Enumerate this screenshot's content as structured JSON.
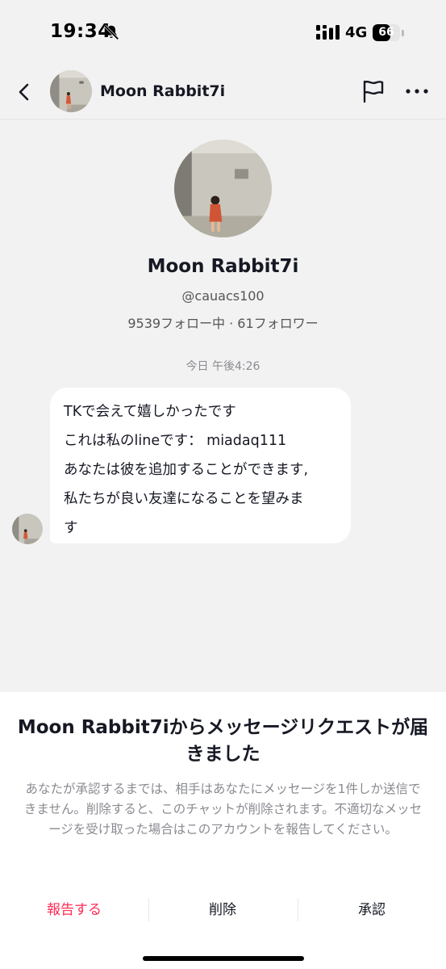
{
  "status_bar": {
    "time": "19:34",
    "network": "4G",
    "battery_level": "66",
    "battery_fraction": 0.66,
    "icons": [
      "bell-off-icon",
      "signal-icon"
    ]
  },
  "header": {
    "name": "Moon Rabbit7i",
    "icons": [
      "back-icon",
      "flag-icon",
      "more-icon"
    ]
  },
  "profile": {
    "name": "Moon Rabbit7i",
    "handle": "@cauacs100",
    "stats": "9539フォロー中 · 61フォロワー"
  },
  "chat": {
    "timestamp": "今日 午後4:26",
    "message_lines": [
      "TKで会えて嬉しかったです",
      "これは私のlineです： miadaq111",
      "あなたは彼を追加することができます,",
      "私たちが良い友達になることを望みま",
      "す"
    ]
  },
  "request_sheet": {
    "title": "Moon Rabbit7iからメッセージリクエストが届きました",
    "description": "あなたが承認するまでは、相手はあなたにメッセージを1件しか送信できません。削除すると、このチャットが削除されます。不適切なメッセージを受け取った場合はこのアカウントを報告してください。",
    "report_label": "報告する",
    "delete_label": "削除",
    "approve_label": "承認"
  },
  "colors": {
    "report": "#fe2c55",
    "background": "#f2f2f2",
    "sheet": "#ffffff"
  }
}
